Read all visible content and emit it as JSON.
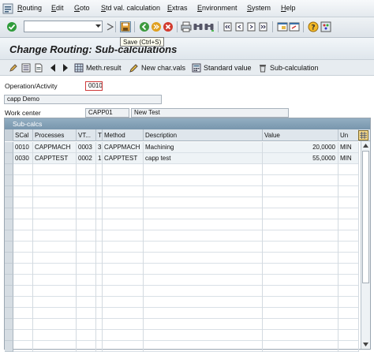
{
  "menubar": {
    "items": [
      "Routing",
      "Edit",
      "Goto",
      "Std val. calculation",
      "Extras",
      "Environment",
      "System",
      "Help"
    ]
  },
  "toolbar": {
    "command_field_value": "",
    "tooltip": "Save   (Ctrl+S)"
  },
  "title": "Change Routing: Sub-calculations",
  "app_toolbar": {
    "buttons": [
      "Meth.result",
      "New char.vals",
      "Standard value",
      "Sub-calculation"
    ]
  },
  "form": {
    "operation_label": "Operation/Activity",
    "operation_value": "0010",
    "description_value": "capp Demo",
    "workcenter_label": "Work center",
    "workcenter_value": "CAPP01",
    "workcenter_desc": "New Test"
  },
  "table": {
    "title": "Sub-calcs",
    "headers": [
      "SCal",
      "Processes",
      "VT...",
      "T",
      "Method",
      "Description",
      "Value",
      "Un"
    ],
    "rows": [
      [
        "0010",
        "CAPPMACH",
        "0003",
        "3",
        "CAPPMACH",
        "Machining",
        "20,0000",
        "MIN"
      ],
      [
        "0030",
        "CAPPTEST",
        "0002",
        "1",
        "CAPPTEST",
        "capp test",
        "55,0000",
        "MIN"
      ]
    ]
  },
  "colors": {
    "table_title_bg": "#7f9db3",
    "required_border": "#cf3c3c"
  }
}
